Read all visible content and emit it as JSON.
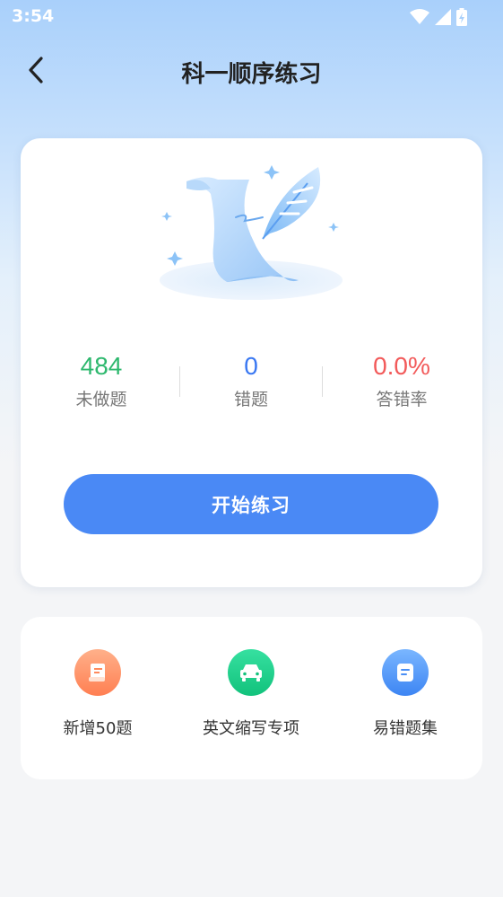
{
  "status_bar": {
    "time": "3:54"
  },
  "nav": {
    "title": "科一顺序练习"
  },
  "stats": [
    {
      "value": "484",
      "label": "未做题",
      "color": "#2eb86e"
    },
    {
      "value": "0",
      "label": "错题",
      "color": "#3a78f2"
    },
    {
      "value": "0.0%",
      "label": "答错率",
      "color": "#f25a5a"
    }
  ],
  "start_button": {
    "label": "开始练习"
  },
  "tools": [
    {
      "label": "新增50题",
      "icon": "scroll-icon",
      "color": "#ff8a5c"
    },
    {
      "label": "英文缩写专项",
      "icon": "car-icon",
      "color": "#1fcf8a"
    },
    {
      "label": "易错题集",
      "icon": "notebook-icon",
      "color": "#4a8ff5"
    }
  ],
  "colors": {
    "accent": "#4a89f5"
  }
}
